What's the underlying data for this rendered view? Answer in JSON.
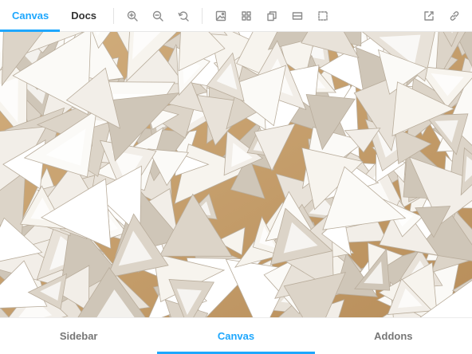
{
  "toolbar": {
    "tabs": [
      {
        "label": "Canvas",
        "active": true
      },
      {
        "label": "Docs",
        "active": false
      }
    ],
    "tools": [
      {
        "icon": "zoom-in-icon"
      },
      {
        "icon": "zoom-out-icon"
      },
      {
        "icon": "reset-zoom-icon"
      },
      {
        "icon": "background-icon"
      },
      {
        "icon": "grid-icon"
      },
      {
        "icon": "viewport-icon"
      },
      {
        "icon": "measure-icon"
      },
      {
        "icon": "outline-icon"
      }
    ],
    "right_tools": [
      {
        "icon": "open-new-tab-icon"
      },
      {
        "icon": "copy-link-icon"
      }
    ]
  },
  "preview": {
    "subject": "faceted-white-triangles-image"
  },
  "bottom_nav": {
    "items": [
      {
        "label": "Sidebar",
        "active": false
      },
      {
        "label": "Canvas",
        "active": true
      },
      {
        "label": "Addons",
        "active": false
      }
    ]
  },
  "colors": {
    "accent": "#1ea7fd",
    "icon": "#8c8c8c",
    "wood": "#c9a679",
    "panel": "#f7f5f1"
  }
}
